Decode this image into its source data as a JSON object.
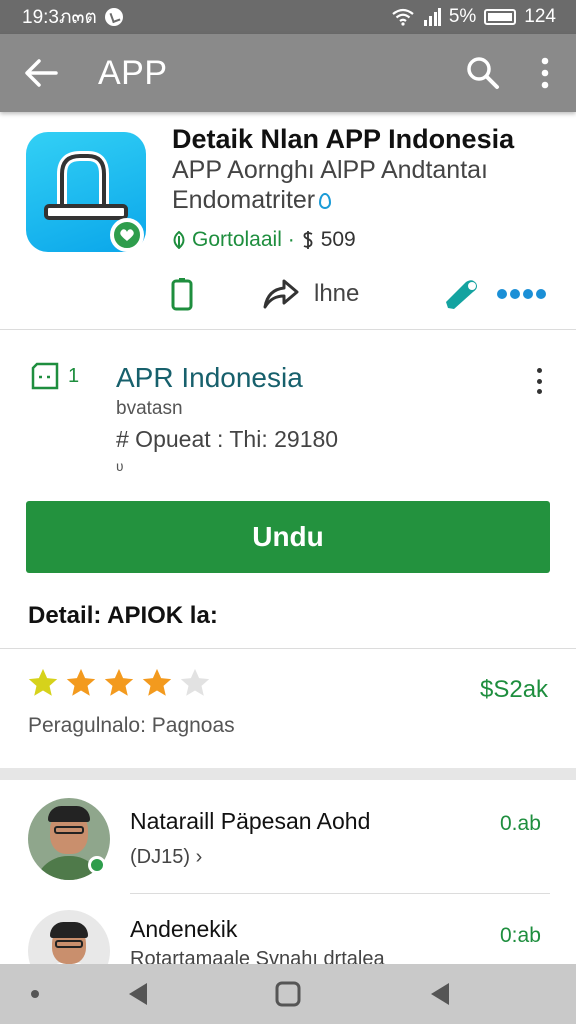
{
  "status_bar": {
    "time": "19:3ภ๓ต",
    "battery_text": "5%",
    "right_text": "124",
    "icons": [
      "wifi-icon",
      "signal-icon",
      "battery-icon"
    ]
  },
  "app_bar": {
    "title": "APP",
    "icons": [
      "back-arrow-icon",
      "search-icon",
      "more-vert-icon"
    ]
  },
  "app_header": {
    "title": "Detaik Nlan APP Indonesia",
    "subtitle_line1": "APP Aornghı AlPP Andtantaı",
    "subtitle_line2": "Endomatriter",
    "meta_text": "Gortolaail · ",
    "meta_price": "509",
    "icon_color": "#0aa6ea",
    "badge_color": "#2e9d4c"
  },
  "actions": {
    "share_label": "lhne",
    "icons": [
      "phone-icon",
      "share-icon",
      "pen-icon",
      "dots-icon"
    ]
  },
  "listing": {
    "number": "1",
    "name": "APR Indonesia",
    "tag": "bvatasn",
    "update": "# Opueat : Thi: 29180",
    "small": "ʋ"
  },
  "install_button": {
    "label": "Undu",
    "color": "#23923e"
  },
  "details": {
    "title": "Detail: APIOK la:"
  },
  "rating": {
    "stars_filled": 4,
    "stars_total": 5,
    "price": "$S2ak",
    "label": "Peragulnalo: Pagnoas"
  },
  "reviews": [
    {
      "name": "Nataraill Päpesan Aohd",
      "sub": "(DJ15) ›",
      "size": "0.ab"
    },
    {
      "name": "Andenekik",
      "sub": "Rotartamaale Svnahı drtalea",
      "size": "0:ab"
    }
  ],
  "nav_bar": {
    "icons": [
      "dot-icon",
      "back-triangle-icon",
      "home-square-icon",
      "recents-triangle-icon"
    ]
  }
}
